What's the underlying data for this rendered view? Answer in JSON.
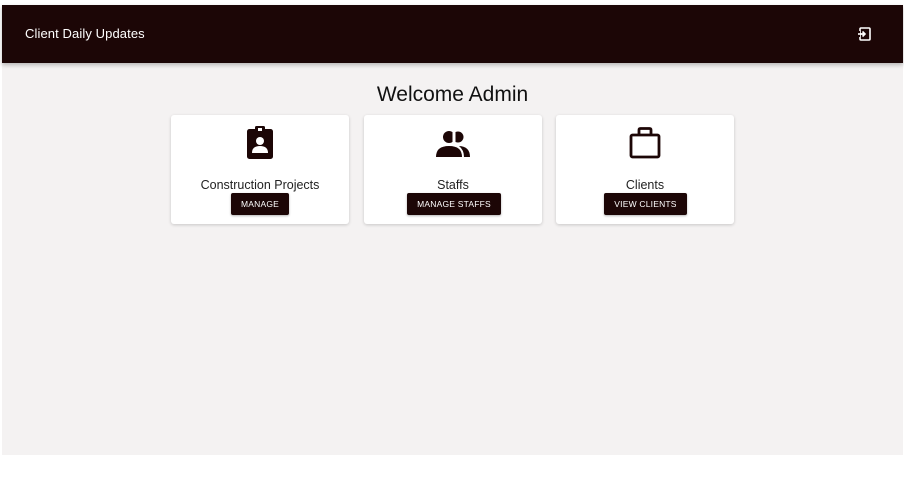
{
  "appbar": {
    "title": "Client Daily Updates",
    "logout_icon": "logout-icon"
  },
  "main": {
    "welcome": "Welcome Admin",
    "cards": [
      {
        "icon": "badge-icon",
        "label": "Construction Projects",
        "button": "MANAGE"
      },
      {
        "icon": "people-icon",
        "label": "Staffs",
        "button": "MANAGE STAFFS"
      },
      {
        "icon": "briefcase-icon",
        "label": "Clients",
        "button": "VIEW CLIENTS"
      }
    ]
  },
  "colors": {
    "primary": "#1c0606",
    "background": "#f4f2f2",
    "card": "#ffffff"
  }
}
